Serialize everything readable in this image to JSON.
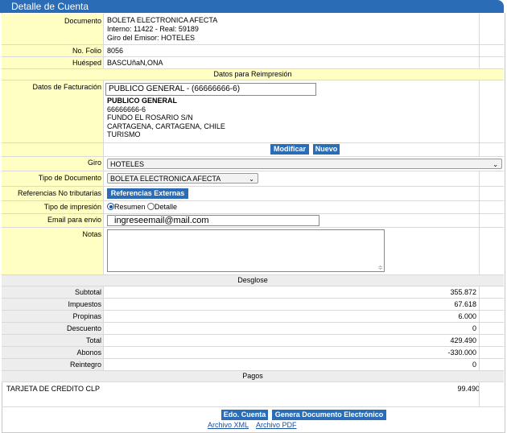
{
  "window": {
    "title": "Detalle de Cuenta"
  },
  "documento": {
    "label": "Documento",
    "line1": "BOLETA ELECTRONICA AFECTA",
    "line2": "Interno: 11422 - Real: 59189",
    "line3": "Giro del Emisor: HOTELES"
  },
  "folio": {
    "label": "No. Folio",
    "value": "8056"
  },
  "huesped": {
    "label": "Huésped",
    "value": "BASCUñaN,ONA"
  },
  "reimpresion": {
    "title": "Datos para Reimpresión"
  },
  "facturacion": {
    "label": "Datos de Facturación",
    "input_value": "PUBLICO GENERAL - (66666666-6)",
    "name": "PUBLICO GENERAL",
    "rut": "66666666-6",
    "address": "FUNDO EL ROSARIO S/N",
    "city": "CARTAGENA, CARTAGENA, CHILE",
    "giro": "TURISMO"
  },
  "actions": {
    "modificar": "Modificar",
    "nuevo": "Nuevo"
  },
  "giro": {
    "label": "Giro",
    "value": "HOTELES"
  },
  "tipo_documento": {
    "label": "Tipo de Documento",
    "value": "BOLETA ELECTRONICA AFECTA"
  },
  "referencias": {
    "label": "Referencias No tributarias",
    "button": "Referencias Externas"
  },
  "impresion": {
    "label": "Tipo de impresión",
    "opt1": "Resumen",
    "opt2": "Detalle",
    "selected": "Resumen"
  },
  "email": {
    "label": "Email para envio",
    "value": "ingreseemail@mail.com"
  },
  "notas": {
    "label": "Notas",
    "value": ""
  },
  "desglose": {
    "title": "Desglose",
    "rows": [
      {
        "label": "Subtotal",
        "value": "355.872"
      },
      {
        "label": "Impuestos",
        "value": "67.618"
      },
      {
        "label": "Propinas",
        "value": "6.000"
      },
      {
        "label": "Descuento",
        "value": "0"
      },
      {
        "label": "Total",
        "value": "429.490"
      },
      {
        "label": "Abonos",
        "value": "-330.000"
      },
      {
        "label": "Reintegro",
        "value": "0"
      }
    ]
  },
  "pagos": {
    "title": "Pagos",
    "rows": [
      {
        "label": "TARJETA DE CREDITO CLP",
        "value": "99.490"
      }
    ]
  },
  "footer": {
    "edo_cuenta": "Edo. Cuenta",
    "genera": "Genera Documento Electrónico",
    "xml": "Archivo XML",
    "pdf": "Archivo PDF"
  }
}
